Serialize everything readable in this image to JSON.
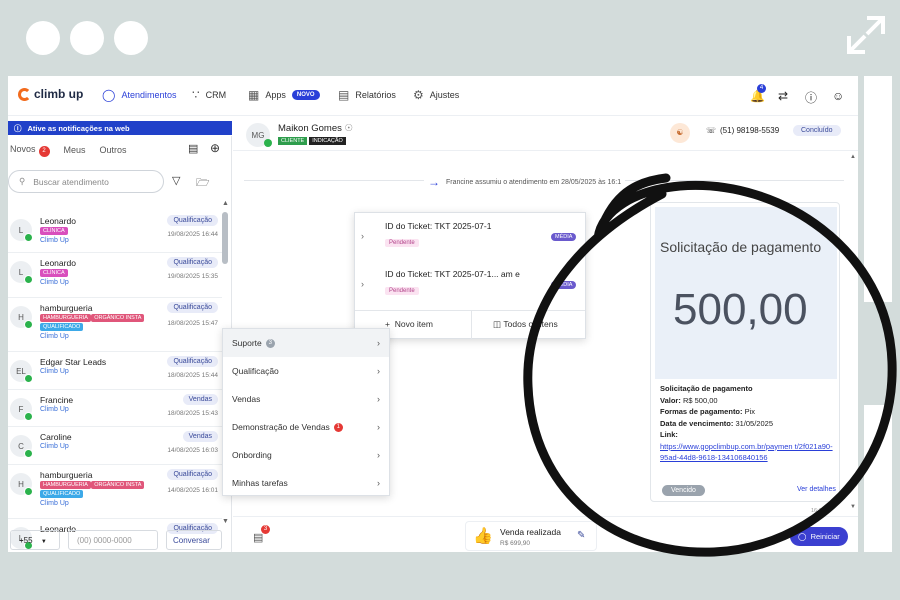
{
  "app": {
    "logo": "climb up"
  },
  "nav": {
    "atendimentos": "Atendimentos",
    "crm": "CRM",
    "apps": "Apps",
    "novo": "NOVO",
    "relatorios": "Relatórios",
    "ajustes": "Ajustes",
    "bell_count": "4"
  },
  "notif": {
    "text": "Ative as notificações na web"
  },
  "tabs": {
    "novos": "Novos",
    "novos_count": "2",
    "meus": "Meus",
    "outros": "Outros"
  },
  "search": {
    "placeholder": "Buscar atendimento"
  },
  "conversations": [
    {
      "initial": "L",
      "name": "Leonardo",
      "tags": [
        {
          "text": "CLÍNICA",
          "color": "#d94fbd"
        }
      ],
      "company": "Climb Up",
      "status": "Qualificação",
      "time": "19/08/2025 16:44"
    },
    {
      "initial": "L",
      "name": "Leonardo",
      "tags": [
        {
          "text": "CLÍNICA",
          "color": "#d94fbd"
        }
      ],
      "company": "Climb Up",
      "status": "Qualificação",
      "time": "19/08/2025 15:35"
    },
    {
      "initial": "H",
      "name": "hamburgueria",
      "tags": [
        {
          "text": "HAMBURGUERIA",
          "color": "#e0567a"
        },
        {
          "text": "ORGÂNICO INSTA",
          "color": "#e0567a"
        },
        {
          "text": "QUALIFICADO",
          "color": "#3da9e8"
        }
      ],
      "company": "Climb Up",
      "status": "Qualificação",
      "time": "18/08/2025 15:47"
    },
    {
      "initial": "EL",
      "name": "Edgar Star Leads",
      "tags": [],
      "company": "Climb Up",
      "status": "Qualificação",
      "time": "18/08/2025 15:44"
    },
    {
      "initial": "F",
      "name": "Francine",
      "tags": [],
      "company": "Climb Up",
      "status": "Vendas",
      "time": "18/08/2025 15:43"
    },
    {
      "initial": "C",
      "name": "Caroline",
      "tags": [],
      "company": "Climb Up",
      "status": "Vendas",
      "time": "14/08/2025 16:03"
    },
    {
      "initial": "H",
      "name": "hamburgueria",
      "tags": [
        {
          "text": "HAMBURGUERIA",
          "color": "#e0567a"
        },
        {
          "text": "ORGÂNICO INSTA",
          "color": "#e0567a"
        },
        {
          "text": "QUALIFICADO",
          "color": "#3da9e8"
        }
      ],
      "company": "Climb Up",
      "status": "Qualificação",
      "time": "14/08/2025 16:01"
    },
    {
      "initial": "L",
      "name": "Leonardo",
      "tags": [],
      "company": "",
      "status": "Qualificação",
      "time": ""
    }
  ],
  "phone": {
    "code": "+55",
    "placeholder": "(00) 0000-0000",
    "button": "Conversar"
  },
  "menu": [
    {
      "label": "Suporte",
      "count": "3",
      "count_color": "#9aa3ad"
    },
    {
      "label": "Qualificação",
      "count": "",
      "count_color": ""
    },
    {
      "label": "Vendas",
      "count": "",
      "count_color": ""
    },
    {
      "label": "Demonstração de Vendas",
      "count": "1",
      "count_color": "#e53935"
    },
    {
      "label": "Onbording",
      "count": "",
      "count_color": ""
    },
    {
      "label": "Minhas tarefas",
      "count": "",
      "count_color": ""
    }
  ],
  "contact": {
    "initials": "MG",
    "name": "Maikon Gomes",
    "tag1": "CLIENTE",
    "tag2": "INDICAÇÃO",
    "phone": "(51) 98198-5539",
    "status": "Concluído"
  },
  "system_msg": "Francine assumiu o atendimento em 28/05/2025 às 16:1",
  "tickets": [
    {
      "id": "ID do Ticket: TKT 2025-07-1",
      "status": "Pendente",
      "priority": "MÉDIA"
    },
    {
      "id": "ID do Ticket: TKT 2025-07-1... am e",
      "status": "Pendente",
      "priority": "MÉDIA"
    }
  ],
  "ticket_actions": {
    "new": "Novo item",
    "all": "Todos os itens"
  },
  "payment": {
    "banner_title": "Solicitação de pagamento",
    "banner_amount": "500,00",
    "title": "Solicitação de pagamento",
    "valor_label": "Valor:",
    "valor": "R$ 500,00",
    "forma_label": "Formas de pagamento:",
    "forma": "Pix",
    "venc_label": "Data de vencimento:",
    "venc": "31/05/2025",
    "link_label": "Link:",
    "link": "https://www.gopclimbup.com.br/paymen t/2f021a90-95ad-44d8-9618-134106840156",
    "badge": "Vencido",
    "details": "Ver detalhes",
    "time": "16:18"
  },
  "footer": {
    "sale_title": "Venda realizada",
    "sale_value": "R$ 699,90",
    "restart": "Reiniciar",
    "tasks_count": "3"
  }
}
